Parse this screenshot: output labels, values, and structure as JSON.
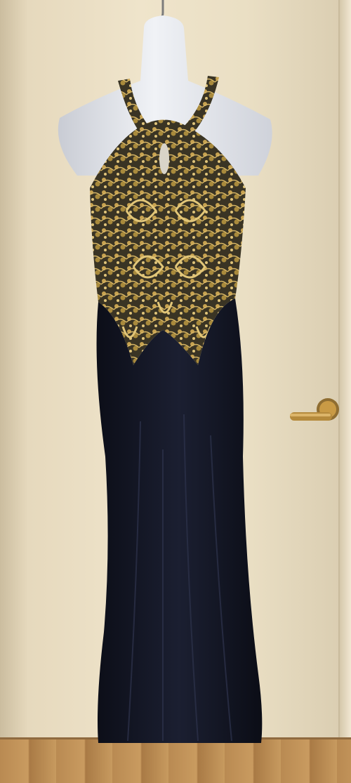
{
  "scene": {
    "subject": "dress-on-mannequin",
    "colors": {
      "wall": "#ece0c6",
      "mannequin": "#e4e6ec",
      "dress": "#131624",
      "gold_lace": "#b8953f",
      "door_handle": "#b58a3c",
      "floor": "#c0905a"
    }
  }
}
